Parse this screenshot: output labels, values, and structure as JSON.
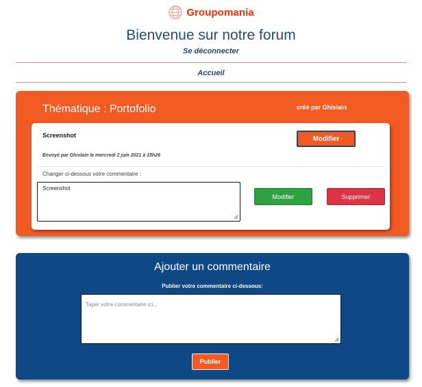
{
  "header": {
    "brand": "Groupomania",
    "logo_icon": "globe-icon",
    "brand_color": "#fd2d01",
    "title": "Bienvenue sur notre forum",
    "logout_label": "Se déconnecter"
  },
  "nav": {
    "home_label": "Accueil"
  },
  "theme": {
    "title": "Thématique : Portofolio",
    "author": "créé par Ghislain",
    "accent_color": "#f15a22"
  },
  "post": {
    "title": "Screenshot",
    "meta": "Envoyé par Ghislain le mercredi 2 juin 2021 à 15h26",
    "modify_top_label": "Modifier",
    "change_label": "Changer ci-dessous votre commentaire :",
    "edit_value": "Screenshot",
    "modify_label": "Modifier",
    "delete_label": "Supprimer",
    "modify_color": "#2ca241",
    "delete_color": "#dc3346"
  },
  "add_comment": {
    "title": "Ajouter un commentaire",
    "label": "Publier votre commentaire ci-dessous:",
    "placeholder": "Taper votre commentaire ici...",
    "publish_label": "Publier",
    "card_color": "#0e4986"
  }
}
